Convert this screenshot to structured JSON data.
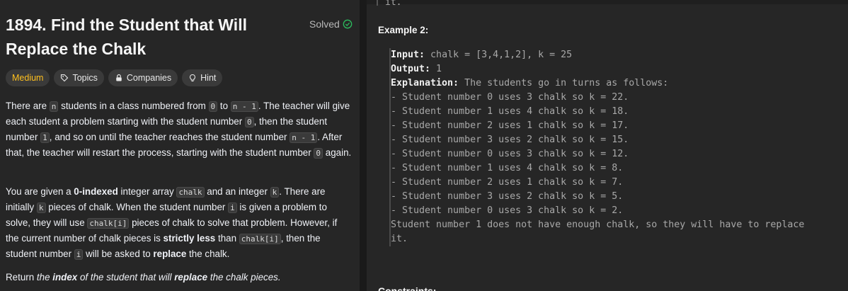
{
  "problem": {
    "title": "1894. Find the Student that Will Replace the Chalk",
    "solved_label": "Solved",
    "tags": {
      "difficulty": "Medium",
      "topics": "Topics",
      "companies": "Companies",
      "hint": "Hint"
    },
    "para1": [
      "There are ",
      "n",
      " students in a class numbered from ",
      "0",
      " to ",
      "n - 1",
      ". The teacher will give each student a problem starting with the student number ",
      "0",
      ", then the student number ",
      "1",
      ", and so on until the teacher reaches the student number ",
      "n - 1",
      ". After that, the teacher will restart the process, starting with the student number ",
      "0",
      " again."
    ],
    "para2": [
      "You are given a ",
      "0-indexed",
      " integer array ",
      "chalk",
      " and an integer ",
      "k",
      ". There are initially ",
      "k",
      " pieces of chalk. When the student number ",
      "i",
      " is given a problem to solve, they will use ",
      "chalk[i]",
      " pieces of chalk to solve that problem. However, if the current number of chalk pieces is ",
      "strictly less",
      " than ",
      "chalk[i]",
      ", then the student number ",
      "i",
      " will be asked to ",
      "replace",
      " the chalk."
    ],
    "para3": [
      "Return ",
      "the ",
      "index",
      " of the student that will ",
      "replace",
      " the chalk pieces."
    ]
  },
  "example": {
    "cut_text": "it.",
    "title": "Example 2:",
    "input_label": "Input:",
    "input_value": " chalk = [3,4,1,2], k = 25",
    "output_label": "Output:",
    "output_value": " 1",
    "explanation_label": "Explanation:",
    "explanation_value": " The students go in turns as follows:",
    "steps": [
      "- Student number 0 uses 3 chalk so k = 22.",
      "- Student number 1 uses 4 chalk so k = 18.",
      "- Student number 2 uses 1 chalk so k = 17.",
      "- Student number 3 uses 2 chalk so k = 15.",
      "- Student number 0 uses 3 chalk so k = 12.",
      "- Student number 1 uses 4 chalk so k = 8.",
      "- Student number 2 uses 1 chalk so k = 7.",
      "- Student number 3 uses 2 chalk so k = 5.",
      "- Student number 0 uses 3 chalk so k = 2."
    ],
    "conclusion_1": "Student number 1 does not have enough chalk, so they will have to replace",
    "conclusion_2": "it."
  },
  "constraints_label": "Constraints:",
  "colors": {
    "medium": "#ffc01e",
    "solved": "#2cbb5d",
    "bg": "#262626"
  }
}
